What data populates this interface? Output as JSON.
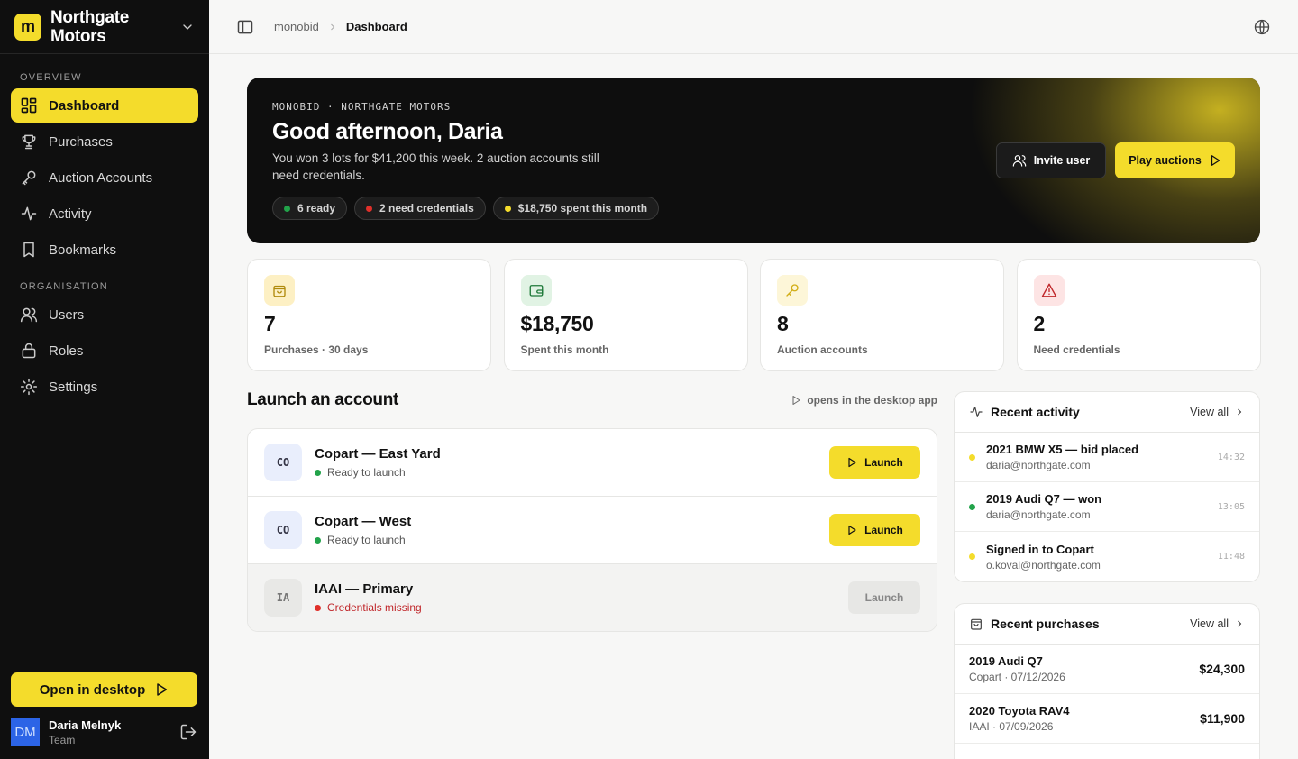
{
  "brand": {
    "logo_letter": "m",
    "name": "Northgate Motors"
  },
  "sidebar": {
    "overview_label": "OVERVIEW",
    "overview_items": [
      {
        "label": "Dashboard",
        "icon": "dashboard-icon",
        "active": true
      },
      {
        "label": "Purchases",
        "icon": "trophy-icon"
      },
      {
        "label": "Auction Accounts",
        "icon": "key-icon"
      },
      {
        "label": "Activity",
        "icon": "activity-icon"
      },
      {
        "label": "Bookmarks",
        "icon": "bookmark-icon"
      }
    ],
    "org_label": "ORGANISATION",
    "org_items": [
      {
        "label": "Users",
        "icon": "users-icon"
      },
      {
        "label": "Roles",
        "icon": "lock-icon"
      },
      {
        "label": "Settings",
        "icon": "gear-icon"
      }
    ],
    "open_desktop_label": "Open in desktop",
    "user": {
      "initials": "DM",
      "name": "Daria Melnyk",
      "role": "Team"
    }
  },
  "topbar": {
    "breadcrumb_root": "monobid",
    "breadcrumb_current": "Dashboard"
  },
  "hero": {
    "eyebrow": "MONOBID · NORTHGATE MOTORS",
    "title": "Good afternoon, Daria",
    "subtitle": "You won 3 lots for $41,200 this week. 2 auction accounts still need credentials.",
    "pills": [
      {
        "label": "6 ready",
        "color": "#22a34a"
      },
      {
        "label": "2 need credentials",
        "color": "#e0302a"
      },
      {
        "label": "$18,750 spent this month",
        "color": "#f4dc2b"
      }
    ],
    "invite_label": "Invite user",
    "play_label": "Play auctions"
  },
  "stats": [
    {
      "value": "7",
      "label": "Purchases · 30 days",
      "icon": "bag-icon",
      "bg": "#fdf3cf",
      "fg": "#b08a0c"
    },
    {
      "value": "$18,750",
      "label": "Spent this month",
      "icon": "wallet-icon",
      "bg": "#e3f4e6",
      "fg": "#1f7a3a"
    },
    {
      "value": "8",
      "label": "Auction accounts",
      "icon": "key-icon",
      "bg": "#fdf6d8",
      "fg": "#c9a612"
    },
    {
      "value": "2",
      "label": "Need credentials",
      "icon": "alert-icon",
      "bg": "#fde6e6",
      "fg": "#c0262a"
    }
  ],
  "launch": {
    "title": "Launch an account",
    "note": "opens in the desktop app",
    "accounts": [
      {
        "badge": "CO",
        "name": "Copart — East Yard",
        "status": "Ready to launch",
        "status_color": "#22a34a",
        "button": "Launch",
        "enabled": true
      },
      {
        "badge": "CO",
        "name": "Copart — West",
        "status": "Ready to launch",
        "status_color": "#22a34a",
        "button": "Launch",
        "enabled": true
      },
      {
        "badge": "IA",
        "name": "IAAI — Primary",
        "status": "Credentials missing",
        "status_color": "#e0302a",
        "button": "Launch",
        "enabled": false
      }
    ]
  },
  "recent_activity": {
    "title": "Recent activity",
    "view_all": "View all",
    "items": [
      {
        "title": "2021 BMW X5 — bid placed",
        "sub": "daria@northgate.com",
        "time": "14:32",
        "color": "#f4dc2b"
      },
      {
        "title": "2019 Audi Q7 — won",
        "sub": "daria@northgate.com",
        "time": "13:05",
        "color": "#22a34a"
      },
      {
        "title": "Signed in to Copart",
        "sub": "o.koval@northgate.com",
        "time": "11:48",
        "color": "#f4dc2b"
      }
    ]
  },
  "recent_purchases": {
    "title": "Recent purchases",
    "view_all": "View all",
    "items": [
      {
        "title": "2019 Audi Q7",
        "sub": "Copart · 07/12/2026",
        "price": "$24,300"
      },
      {
        "title": "2020 Toyota RAV4",
        "sub": "IAAI · 07/09/2026",
        "price": "$11,900"
      }
    ]
  }
}
